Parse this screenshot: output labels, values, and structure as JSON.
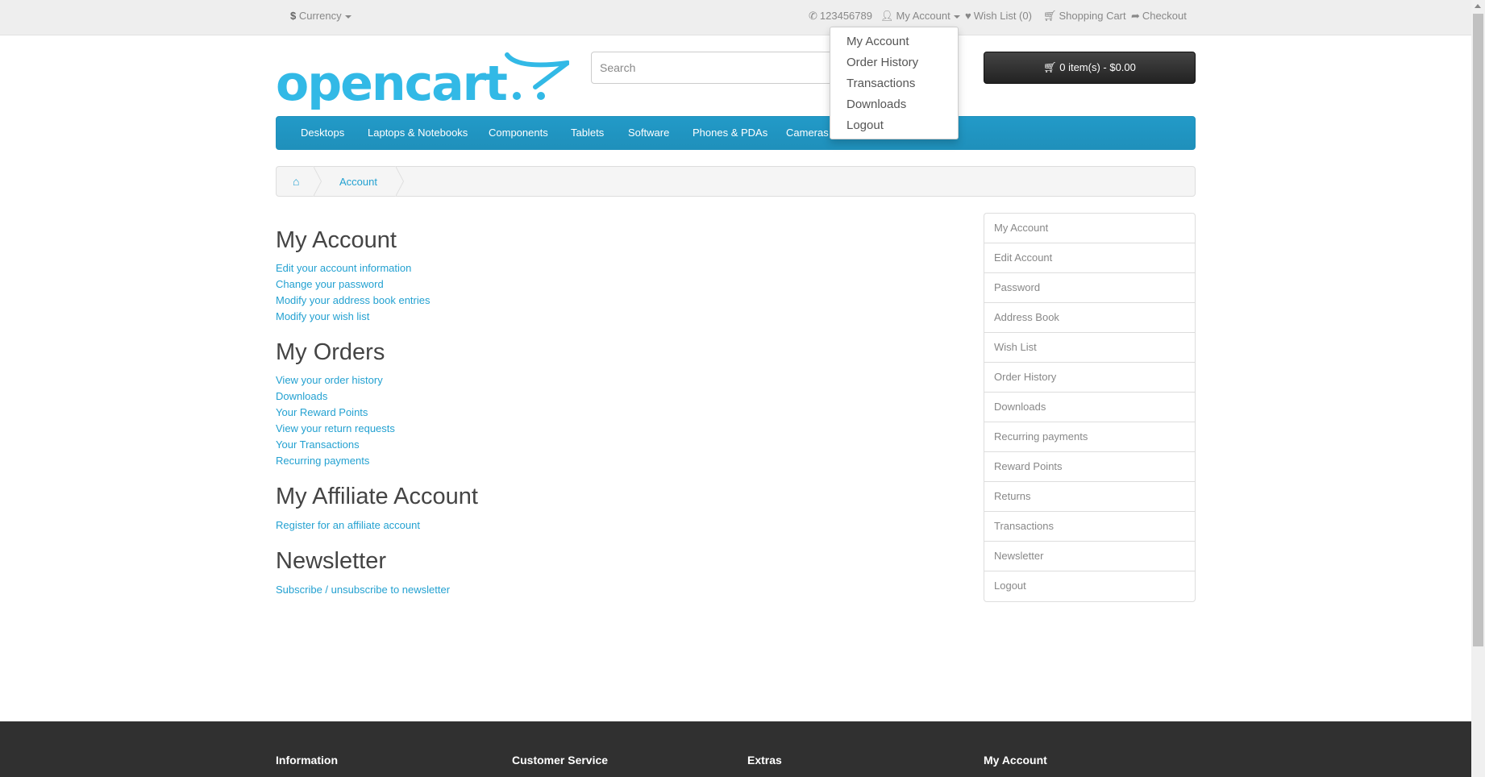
{
  "topbar": {
    "currency_symbol": "$",
    "currency_label": "Currency",
    "phone": "123456789",
    "my_account": "My Account",
    "wishlist": "Wish List (0)",
    "shopping_cart": "Shopping Cart",
    "checkout": "Checkout"
  },
  "account_dropdown": {
    "items": [
      "My Account",
      "Order History",
      "Transactions",
      "Downloads",
      "Logout"
    ]
  },
  "header": {
    "logo_text": "opencart",
    "search_placeholder": "Search",
    "cart_button": "0 item(s) - $0.00"
  },
  "menu": {
    "items": [
      "Desktops",
      "Laptops & Notebooks",
      "Components",
      "Tablets",
      "Software",
      "Phones & PDAs",
      "Cameras"
    ]
  },
  "breadcrumb": {
    "account": "Account"
  },
  "sections": {
    "my_account": {
      "title": "My Account",
      "links": [
        "Edit your account information",
        "Change your password",
        "Modify your address book entries",
        "Modify your wish list"
      ]
    },
    "my_orders": {
      "title": "My Orders",
      "links": [
        "View your order history",
        "Downloads",
        "Your Reward Points",
        "View your return requests",
        "Your Transactions",
        "Recurring payments"
      ]
    },
    "affiliate": {
      "title": "My Affiliate Account",
      "links": [
        "Register for an affiliate account"
      ]
    },
    "newsletter": {
      "title": "Newsletter",
      "links": [
        "Subscribe / unsubscribe to newsletter"
      ]
    }
  },
  "sidebar": {
    "items": [
      "My Account",
      "Edit Account",
      "Password",
      "Address Book",
      "Wish List",
      "Order History",
      "Downloads",
      "Recurring payments",
      "Reward Points",
      "Returns",
      "Transactions",
      "Newsletter",
      "Logout"
    ]
  },
  "footer": {
    "headings": [
      "Information",
      "Customer Service",
      "Extras",
      "My Account"
    ]
  },
  "colors": {
    "accent": "#23a1d1",
    "menu_bg": "#229ac8",
    "footer_bg": "#303030"
  }
}
